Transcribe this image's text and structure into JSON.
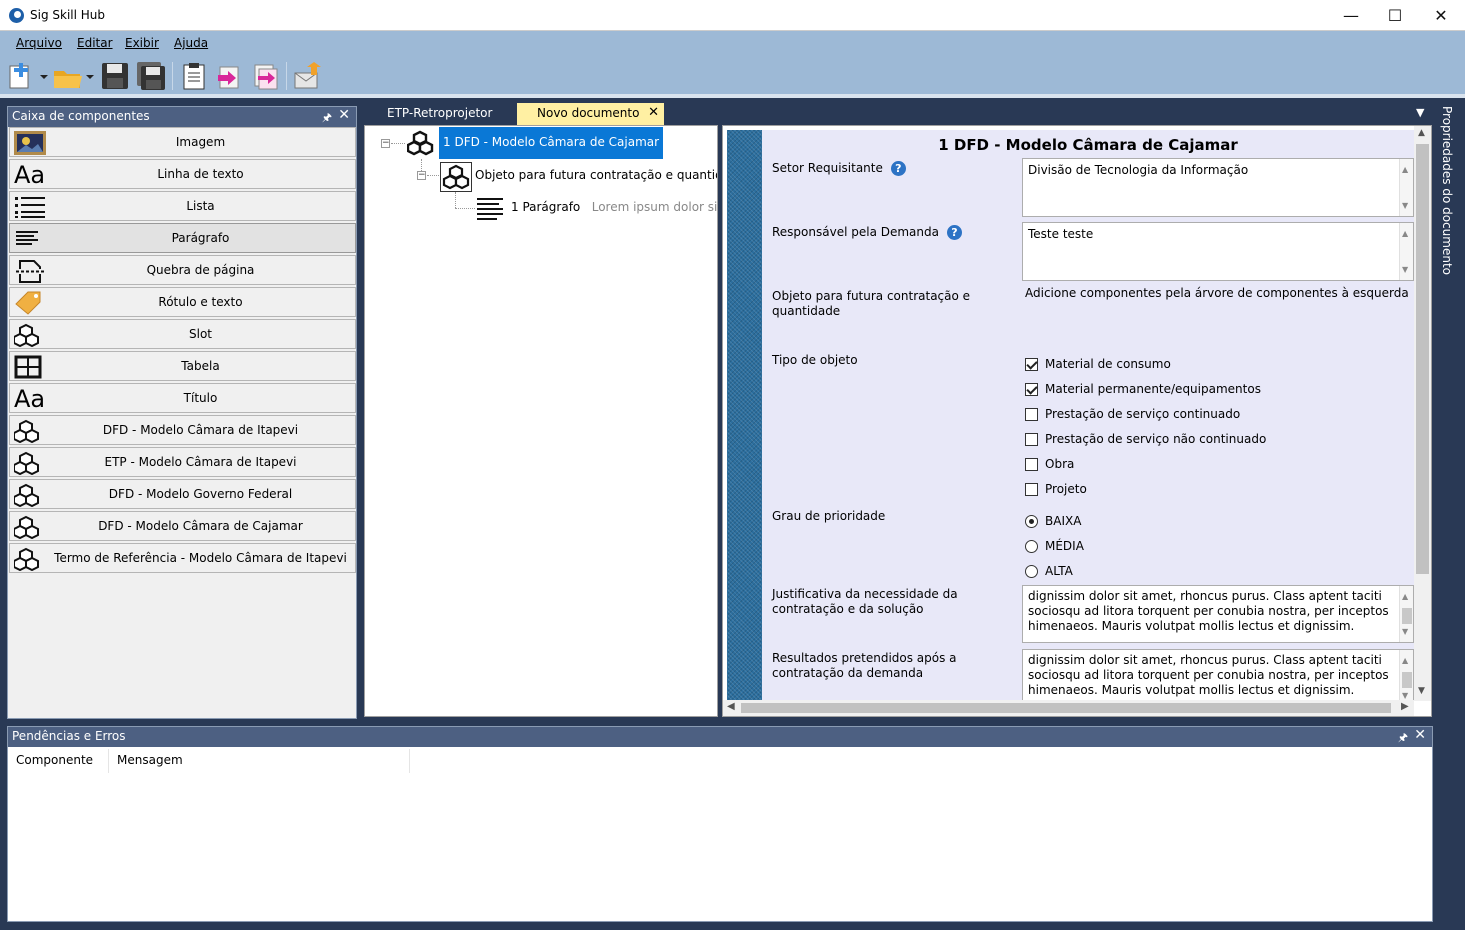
{
  "window": {
    "title": "Sig Skill Hub",
    "minimize": "—",
    "maximize": "☐",
    "close": "✕"
  },
  "menu": [
    "Arquivo",
    "Editar",
    "Exibir",
    "Ajuda"
  ],
  "toolbox": {
    "title": "Caixa de componentes",
    "items": [
      {
        "label": "Imagem",
        "icon": "image-icon"
      },
      {
        "label": "Linha de texto",
        "icon": "text-line-icon"
      },
      {
        "label": "Lista",
        "icon": "list-icon"
      },
      {
        "label": "Parágrafo",
        "icon": "paragraph-icon"
      },
      {
        "label": "Quebra de página",
        "icon": "page-break-icon"
      },
      {
        "label": "Rótulo e texto",
        "icon": "tag-icon"
      },
      {
        "label": "Slot",
        "icon": "cubes-icon"
      },
      {
        "label": "Tabela",
        "icon": "table-icon"
      },
      {
        "label": "Título",
        "icon": "title-icon"
      },
      {
        "label": "DFD - Modelo Câmara de Itapevi",
        "icon": "cubes-icon"
      },
      {
        "label": "ETP - Modelo Câmara de Itapevi",
        "icon": "cubes-icon"
      },
      {
        "label": "DFD - Modelo Governo Federal",
        "icon": "cubes-icon"
      },
      {
        "label": "DFD - Modelo Câmara de Cajamar",
        "icon": "cubes-icon"
      },
      {
        "label": "Termo de Referência - Modelo Câmara de Itapevi",
        "icon": "cubes-icon"
      }
    ]
  },
  "tabs": [
    {
      "label": "ETP-Retroprojetor",
      "active": false
    },
    {
      "label": "Novo documento",
      "active": true
    }
  ],
  "tree": {
    "root": "1 DFD - Modelo Câmara de Cajamar",
    "child": "Objeto para futura contratação e quantidade",
    "grandchild": "1 Parágrafo",
    "grandchild_desc": "Lorem ipsum dolor sit ame"
  },
  "doc": {
    "title": "1 DFD - Modelo Câmara de Cajamar",
    "setor_label": "Setor Requisitante",
    "setor_value": "Divisão de Tecnologia da Informação",
    "responsavel_label": "Responsável pela Demanda",
    "responsavel_value": "Teste teste",
    "objeto_label": "Objeto para futura contratação e quantidade",
    "objeto_hint": "Adicione componentes pela árvore de componentes à esquerda",
    "tipo_label": "Tipo de objeto",
    "tipo_options": [
      {
        "label": "Material de consumo",
        "checked": true
      },
      {
        "label": "Material permanente/equipamentos",
        "checked": true
      },
      {
        "label": "Prestação de serviço continuado",
        "checked": false
      },
      {
        "label": "Prestação de serviço não continuado",
        "checked": false
      },
      {
        "label": "Obra",
        "checked": false
      },
      {
        "label": "Projeto",
        "checked": false
      }
    ],
    "prioridade_label": "Grau de prioridade",
    "prioridade_options": [
      {
        "label": "BAIXA",
        "selected": true
      },
      {
        "label": "MÉDIA",
        "selected": false
      },
      {
        "label": "ALTA",
        "selected": false
      }
    ],
    "justificativa_label": "Justificativa da necessidade da contratação e da solução",
    "justificativa_value": "dignissim dolor sit amet, rhoncus purus. Class aptent taciti sociosqu ad litora torquent per conubia nostra, per inceptos himenaeos. Mauris volutpat mollis lectus et dignissim.",
    "resultados_label": "Resultados pretendidos após a contratação da demanda",
    "resultados_value": "dignissim dolor sit amet, rhoncus purus. Class aptent taciti sociosqu ad litora torquent per conubia nostra, per inceptos himenaeos. Mauris volutpat mollis lectus et dignissim."
  },
  "side_panel": {
    "label": "Propriedades do documento"
  },
  "errors_panel": {
    "title": "Pendências e Erros",
    "columns": [
      "Componente",
      "Mensagem"
    ]
  }
}
